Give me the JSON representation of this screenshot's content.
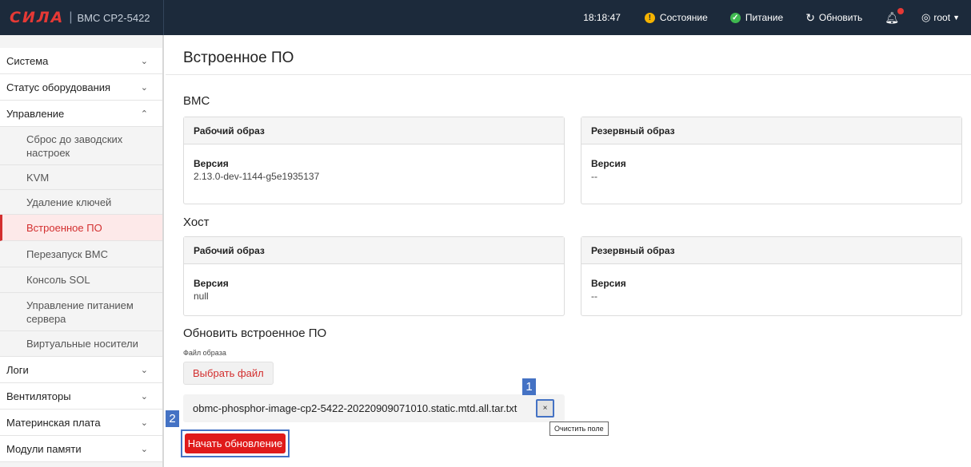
{
  "header": {
    "logo": "СИЛА",
    "separator": "|",
    "model": "BMC CP2-5422",
    "time": "18:18:47",
    "status_label": "Состояние",
    "status_color": "#f5b301",
    "power_label": "Питание",
    "power_color": "#3fb950",
    "refresh_label": "Обновить",
    "user_label": "root",
    "icons": [
      "warning-icon",
      "check-circle-icon",
      "refresh-icon",
      "bell-icon",
      "user-circle-icon",
      "caret-down-icon"
    ]
  },
  "sidebar": {
    "groups_top": [
      {
        "label": "Система",
        "chevron": "⌄"
      },
      {
        "label": "Статус оборудования",
        "chevron": "⌄"
      },
      {
        "label": "Управление",
        "chevron": "⌃"
      }
    ],
    "sub_items": [
      {
        "label": "Сброс до заводских настроек",
        "active": false
      },
      {
        "label": "KVM",
        "active": false
      },
      {
        "label": "Удаление ключей",
        "active": false
      },
      {
        "label": "Встроенное ПО",
        "active": true
      },
      {
        "label": "Перезапуск BMC",
        "active": false
      },
      {
        "label": "Консоль SOL",
        "active": false
      },
      {
        "label": "Управление питанием сервера",
        "active": false
      },
      {
        "label": "Виртуальные носители",
        "active": false
      }
    ],
    "groups_bottom": [
      {
        "label": "Логи",
        "chevron": "⌄"
      },
      {
        "label": "Вентиляторы",
        "chevron": "⌄"
      },
      {
        "label": "Материнская плата",
        "chevron": "⌄"
      },
      {
        "label": "Модули памяти",
        "chevron": "⌄"
      }
    ],
    "accent_color": "#d32f2f"
  },
  "main": {
    "title": "Встроенное ПО",
    "bmc": {
      "heading": "BMC",
      "primary": {
        "title": "Рабочий образ",
        "version_label": "Версия",
        "version": "2.13.0-dev-1144-g5e1935137"
      },
      "backup": {
        "title": "Резервный образ",
        "version_label": "Версия",
        "version": "--"
      }
    },
    "host": {
      "heading": "Хост",
      "primary": {
        "title": "Рабочий образ",
        "version_label": "Версия",
        "version": "null"
      },
      "backup": {
        "title": "Резервный образ",
        "version_label": "Версия",
        "version": "--"
      }
    },
    "update": {
      "heading": "Обновить встроенное ПО",
      "file_label": "Файл образа",
      "choose_label": "Выбрать файл",
      "file_name": "obmc-phosphor-image-cp2-5422-20220909071010.static.mtd.all.tar.txt",
      "clear_glyph": "×",
      "clear_tooltip": "Очистить поле",
      "start_label": "Начать обновление"
    },
    "callouts": [
      "1",
      "2"
    ]
  }
}
